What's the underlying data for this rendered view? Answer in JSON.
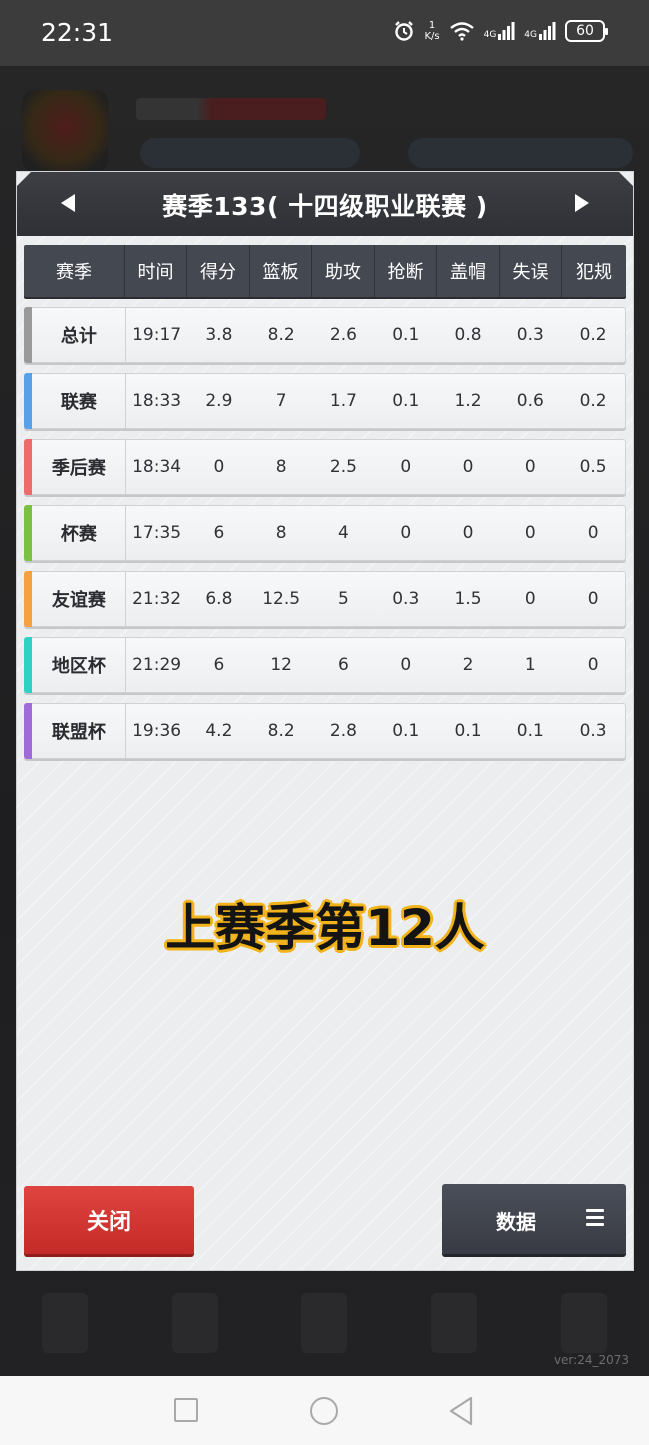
{
  "status_bar": {
    "time": "22:31",
    "speed_value": "1",
    "speed_unit": "K/s",
    "net1": "4G",
    "net2": "4G",
    "battery": "60"
  },
  "modal": {
    "title": "赛季133( 十四级职业联赛 )",
    "columns": [
      "赛季",
      "时间",
      "得分",
      "篮板",
      "助攻",
      "抢断",
      "盖帽",
      "失误",
      "犯规"
    ],
    "rows": [
      {
        "label": "总计",
        "accent": "#9a9a9a",
        "values": [
          "19:17",
          "3.8",
          "8.2",
          "2.6",
          "0.1",
          "0.8",
          "0.3",
          "0.2"
        ]
      },
      {
        "label": "联赛",
        "accent": "#5aa0e8",
        "values": [
          "18:33",
          "2.9",
          "7",
          "1.7",
          "0.1",
          "1.2",
          "0.6",
          "0.2"
        ]
      },
      {
        "label": "季后赛",
        "accent": "#ee6b6b",
        "values": [
          "18:34",
          "0",
          "8",
          "2.5",
          "0",
          "0",
          "0",
          "0.5"
        ]
      },
      {
        "label": "杯赛",
        "accent": "#7bc043",
        "values": [
          "17:35",
          "6",
          "8",
          "4",
          "0",
          "0",
          "0",
          "0"
        ]
      },
      {
        "label": "友谊赛",
        "accent": "#f5a142",
        "values": [
          "21:32",
          "6.8",
          "12.5",
          "5",
          "0.3",
          "1.5",
          "0",
          "0"
        ]
      },
      {
        "label": "地区杯",
        "accent": "#2fd1c5",
        "values": [
          "21:29",
          "6",
          "12",
          "6",
          "0",
          "2",
          "1",
          "0"
        ]
      },
      {
        "label": "联盟杯",
        "accent": "#a06ad8",
        "values": [
          "19:36",
          "4.2",
          "8.2",
          "2.8",
          "0.1",
          "0.1",
          "0.1",
          "0.3"
        ]
      }
    ],
    "overlay_text": "上赛季第12人",
    "close_label": "关闭",
    "data_label": "数据"
  },
  "version": "ver:24_2073"
}
